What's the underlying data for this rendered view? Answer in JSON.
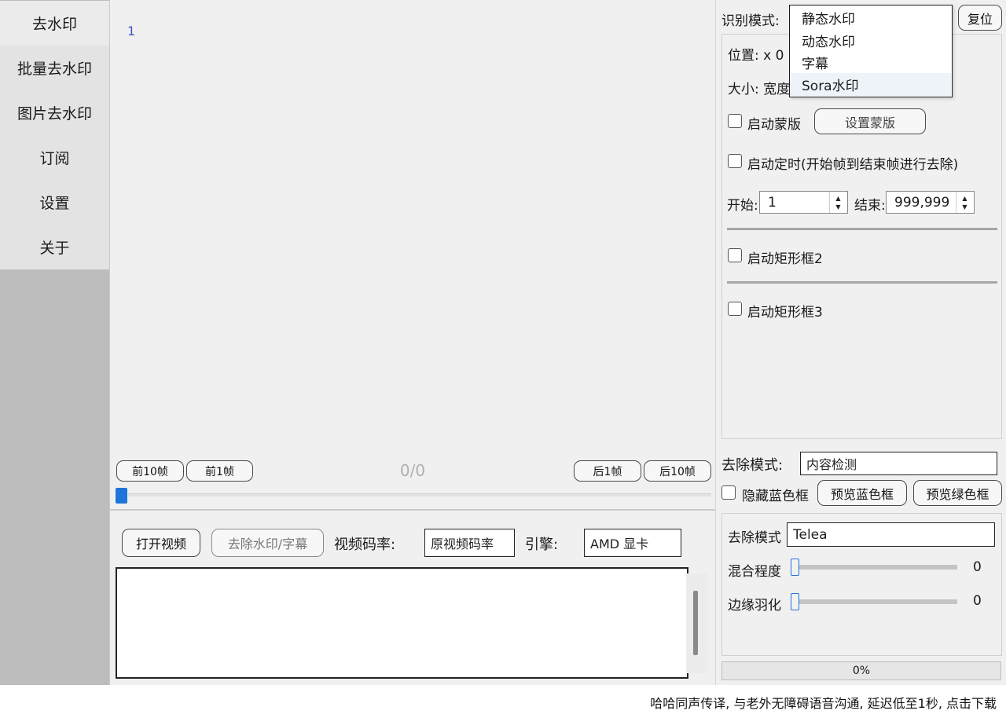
{
  "sidebar": {
    "items": [
      {
        "label": "去水印",
        "active": true
      },
      {
        "label": "批量去水印"
      },
      {
        "label": "图片去水印"
      },
      {
        "label": "订阅"
      },
      {
        "label": "设置"
      },
      {
        "label": "关于"
      }
    ]
  },
  "preview": {
    "line_number": "1",
    "frame_counter": "0/0"
  },
  "frame_nav": {
    "prev10": "前10帧",
    "prev1": "前1帧",
    "next1": "后1帧",
    "next10": "后10帧"
  },
  "toolbar": {
    "open_video": "打开视频",
    "remove_watermark": "去除水印/字幕",
    "bitrate_label": "视频码率:",
    "bitrate_value": "原视频码率",
    "engine_label": "引擎:",
    "engine_value": "AMD 显卡"
  },
  "right_panel": {
    "detect_mode_label": "识别模式:",
    "reset": "复位",
    "dropdown_options": [
      "静态水印",
      "动态水印",
      "字幕",
      "Sora水印"
    ],
    "position_label": "位置: x 0",
    "size_label": "大小: 宽度",
    "enable_mask": "启动蒙版",
    "set_mask": "设置蒙版",
    "enable_timer": "启动定时(开始帧到结束帧进行去除)",
    "start_label": "开始:",
    "start_value": "1",
    "end_label": "结束:",
    "end_value": "999,999",
    "enable_rect2": "启动矩形框2",
    "enable_rect3": "启动矩形框3",
    "removal_mode_label": "去除模式:",
    "removal_mode_value": "内容检测",
    "hide_blue": "隐藏蓝色框",
    "preview_blue": "预览蓝色框",
    "preview_green": "预览绿色框",
    "inpaint_mode_label": "去除模式",
    "inpaint_mode_value": "Telea",
    "blend_label": "混合程度",
    "blend_value": "0",
    "feather_label": "边缘羽化",
    "feather_value": "0",
    "progress_text": "0%",
    "progress": 0
  },
  "footer": {
    "link": "哈哈同声传译, 与老外无障碍语音沟通, 延迟低至1秒, 点击下载"
  },
  "colors": {
    "accent": "#1e74d8",
    "sidebar_bg": "#bdbdbd",
    "panel_bg": "#f0f0f0"
  }
}
